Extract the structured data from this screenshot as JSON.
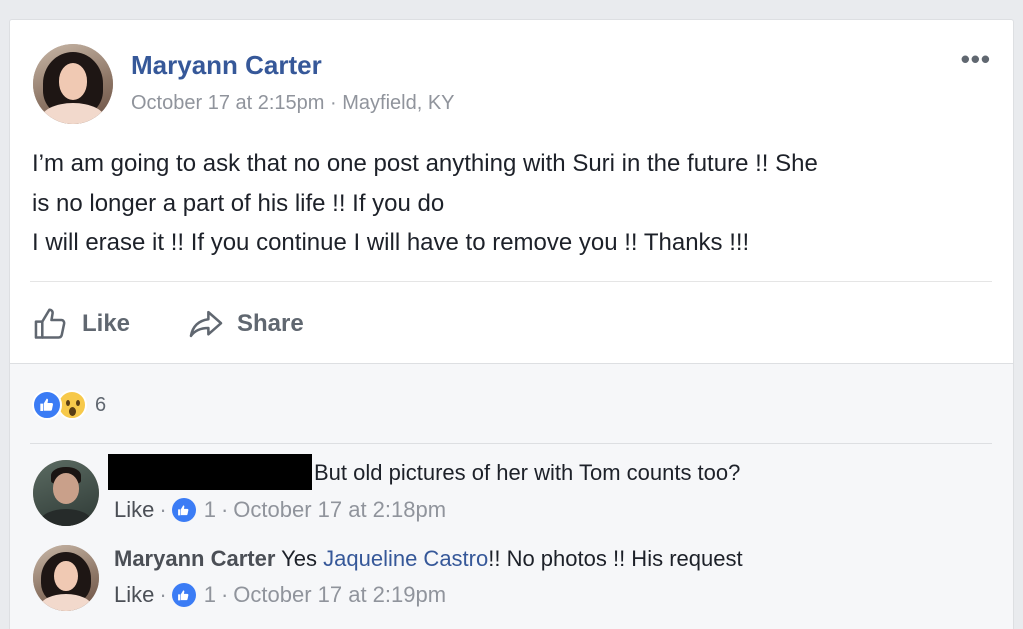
{
  "post": {
    "author": "Maryann Carter",
    "timestamp": "October 17 at 2:15pm",
    "separator": "·",
    "location": "Mayfield, KY",
    "more_label": "•••",
    "text_line1": "I’m am going to ask that no one post anything with Suri in the future !! She",
    "text_line2": "is no longer a part of his life !! If you do",
    "text_line3": "I will erase it !! If you continue I will have to remove you !! Thanks !!!"
  },
  "actions": {
    "like_label": "Like",
    "share_label": "Share"
  },
  "reactions": {
    "icons": [
      "like-reaction-icon",
      "wow-reaction-icon"
    ],
    "count": "6"
  },
  "comments": [
    {
      "name": "",
      "name_redacted": true,
      "text": "But old pictures of her with Tom counts too?",
      "like_label": "Like",
      "separator": "·",
      "like_count": "1",
      "time": "October 17 at 2:18pm"
    },
    {
      "name": "Maryann Carter",
      "text_before": "Yes ",
      "mention": "Jaqueline Castro",
      "text_after": "!! No photos !! His request",
      "like_label": "Like",
      "separator": "·",
      "like_count": "1",
      "time": "October 17 at 2:19pm"
    }
  ],
  "colors": {
    "link_blue": "#365899",
    "like_blue": "#3b7cf5",
    "background": "#e9ebee",
    "meta_gray": "#90949c"
  }
}
